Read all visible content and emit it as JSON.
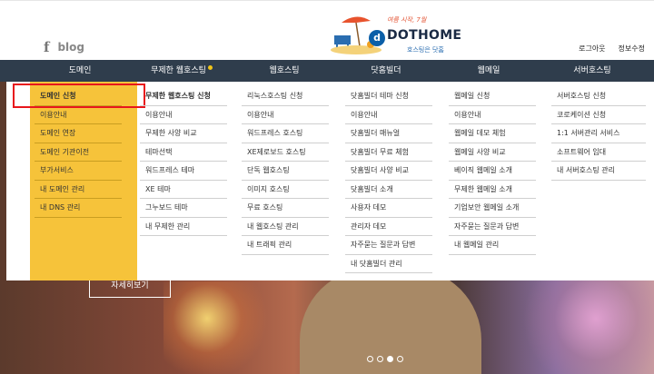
{
  "header": {
    "blog_label": "blog",
    "logo": {
      "tagline": "여름 시작, 7월",
      "badge": "d",
      "name": "DOTHOME",
      "sub": "호스팅은 닷홈"
    },
    "login": "로그아웃",
    "info": "정보수정"
  },
  "nav": {
    "items": [
      {
        "label": "도메인"
      },
      {
        "label": "무제한 웹호스팅"
      },
      {
        "label": "웹호스팅"
      },
      {
        "label": "닷홈빌더"
      },
      {
        "label": "웹메일"
      },
      {
        "label": "서버호스팅"
      }
    ]
  },
  "menus": {
    "domain": [
      "도메인 신청",
      "이용안내",
      "도메인 연장",
      "도메인 기관이전",
      "부가서비스",
      "내 도메인 관리",
      "내 DNS 관리"
    ],
    "unlimited": [
      "무제한 웹호스팅 신청",
      "이용안내",
      "무제한 사양 비교",
      "테마선택",
      "워드프레스 테마",
      "XE 테마",
      "그누보드 테마",
      "내 무제한 관리"
    ],
    "webhosting": [
      "리눅스호스팅 신청",
      "이용안내",
      "워드프레스 호스팅",
      "XE제로보드 호스팅",
      "단독 웹호스팅",
      "이미지 호스팅",
      "무료 호스팅",
      "내 웹호스팅 관리",
      "내 트래픽 관리"
    ],
    "builder": [
      "닷홈빌더 테마 신청",
      "이용안내",
      "닷홈빌더 매뉴얼",
      "닷홈빌더 무료 체험",
      "닷홈빌더 사양 비교",
      "닷홈빌더 소개",
      "사용자 데모",
      "관리자 데모",
      "자주묻는 질문과 답변",
      "내 닷홈빌더 관리"
    ],
    "webmail": [
      "웹메일 신청",
      "이용안내",
      "웹메일 데모 체험",
      "웹메일 사양 비교",
      "베이직 웹메일 소개",
      "무제한 웹메일 소개",
      "기업보안 웹메일 소개",
      "자주묻는 질문과 답변",
      "내 웹메일 관리"
    ],
    "server": [
      "서버호스팅 신청",
      "코로케이션 신청",
      "1:1 서버관리 서비스",
      "소프트웨어 임대",
      "내 서버호스팅 관리"
    ]
  },
  "hero": {
    "detail_button": "자세히보기"
  },
  "colors": {
    "nav_bg": "#2f3d4c",
    "domain_bg": "#f6c33a",
    "highlight": "#e8161c",
    "new_dot": "#f0c419"
  }
}
